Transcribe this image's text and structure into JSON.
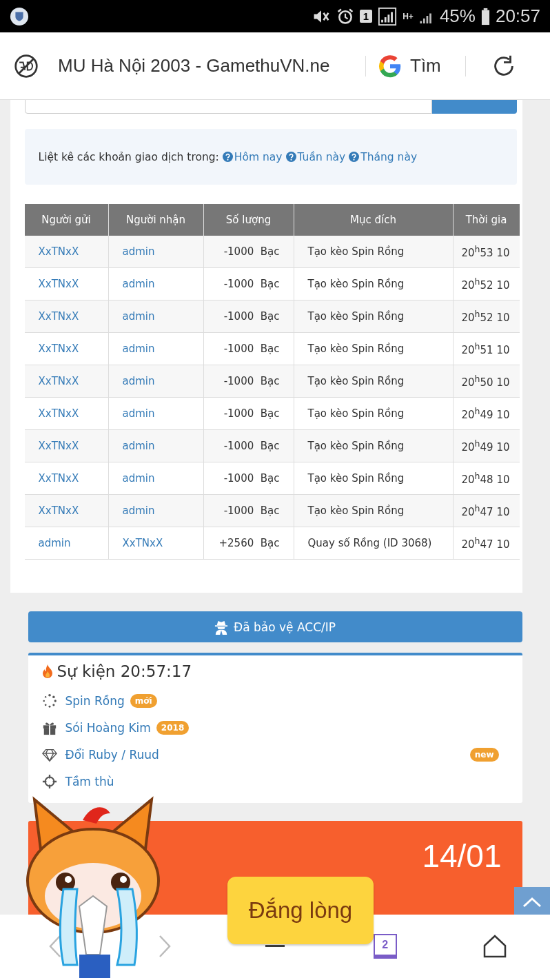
{
  "status_bar": {
    "sim_badge": "1",
    "network_type": "H+",
    "battery": "45%",
    "time": "20:57"
  },
  "browser_bar": {
    "title": "MU Hà Nội 2003 - GamethuVN.ne",
    "search_label": "Tìm"
  },
  "filter": {
    "intro": "Liệt kê các khoản giao dịch trong:",
    "links": [
      "Hôm nay",
      "Tuần này",
      "Tháng này"
    ]
  },
  "table": {
    "columns": [
      "Người gửi",
      "Người nhận",
      "Số lượng",
      "Mục đích",
      "Thời gia"
    ],
    "rows": [
      {
        "sender": "XxTNxX",
        "receiver": "admin",
        "amount": "-1000  Bạc",
        "purpose": "Tạo kèo Spin Rồng",
        "time": "20$^{h}$53 10"
      },
      {
        "sender": "XxTNxX",
        "receiver": "admin",
        "amount": "-1000  Bạc",
        "purpose": "Tạo kèo Spin Rồng",
        "time": "20$^{h}$52 10"
      },
      {
        "sender": "XxTNxX",
        "receiver": "admin",
        "amount": "-1000  Bạc",
        "purpose": "Tạo kèo Spin Rồng",
        "time": "20$^{h}$52 10"
      },
      {
        "sender": "XxTNxX",
        "receiver": "admin",
        "amount": "-1000  Bạc",
        "purpose": "Tạo kèo Spin Rồng",
        "time": "20$^{h}$51 10"
      },
      {
        "sender": "XxTNxX",
        "receiver": "admin",
        "amount": "-1000  Bạc",
        "purpose": "Tạo kèo Spin Rồng",
        "time": "20$^{h}$50 10"
      },
      {
        "sender": "XxTNxX",
        "receiver": "admin",
        "amount": "-1000  Bạc",
        "purpose": "Tạo kèo Spin Rồng",
        "time": "20$^{h}$49 10"
      },
      {
        "sender": "XxTNxX",
        "receiver": "admin",
        "amount": "-1000  Bạc",
        "purpose": "Tạo kèo Spin Rồng",
        "time": "20$^{h}$49 10"
      },
      {
        "sender": "XxTNxX",
        "receiver": "admin",
        "amount": "-1000  Bạc",
        "purpose": "Tạo kèo Spin Rồng",
        "time": "20$^{h}$48 10"
      },
      {
        "sender": "XxTNxX",
        "receiver": "admin",
        "amount": "-1000  Bạc",
        "purpose": "Tạo kèo Spin Rồng",
        "time": "20$^{h}$47 10"
      },
      {
        "sender": "admin",
        "receiver": "XxTNxX",
        "amount": "+2560  Bạc",
        "purpose": "Quay số Rồng (ID 3068)",
        "time": "20$^{h}$47 10"
      }
    ]
  },
  "protect_button": "Đã bảo vệ ACC/IP",
  "events": {
    "title": "Sự kiện 20:57:17",
    "items": [
      {
        "kind": "spinner",
        "label": "Spin Rồng",
        "badge": "mới",
        "badge_at_end": false
      },
      {
        "kind": "gift",
        "label": "Sói Hoàng Kim",
        "badge": "2018",
        "badge_at_end": false
      },
      {
        "kind": "diamond",
        "label": "Đổi Ruby / Ruud",
        "badge": "new",
        "badge_at_end": true
      },
      {
        "kind": "crosshair",
        "label": "Tầm thù"
      }
    ]
  },
  "banner": {
    "date": "14/01"
  },
  "sticker": {
    "caption": "Đắng lòng"
  },
  "bottom_nav": {
    "tab_count": "2"
  }
}
